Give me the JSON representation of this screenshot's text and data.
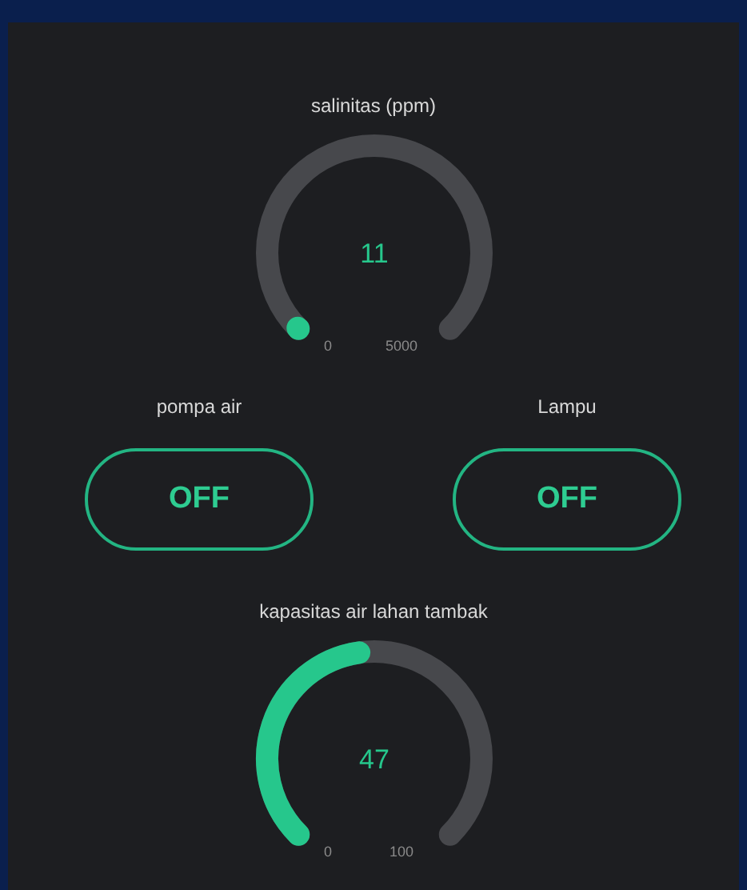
{
  "widgets": [
    {
      "kind": "gauge",
      "title": "salinitas (ppm)",
      "value": "11",
      "min": "0",
      "max": "5000"
    },
    {
      "kind": "switches",
      "items": [
        {
          "label": "pompa air",
          "state": "OFF",
          "on": false
        },
        {
          "label": "Lampu",
          "state": "OFF",
          "on": false
        }
      ]
    },
    {
      "kind": "gauge",
      "title": "kapasitas air lahan tambak",
      "value": "47",
      "min": "0",
      "max": "100"
    }
  ]
}
